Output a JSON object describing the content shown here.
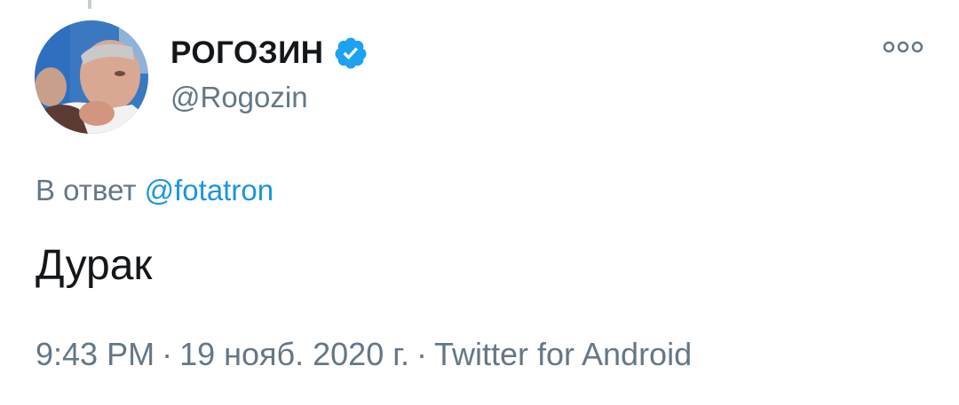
{
  "tweet": {
    "display_name": "РОГОЗИН",
    "handle": "@Rogozin",
    "reply_prefix": "В ответ",
    "reply_mention": "@fotatron",
    "text": "Дурак",
    "time": "9:43 PM",
    "date": "19 нояб. 2020 г.",
    "source": "Twitter for Android",
    "separator": "·"
  },
  "icons": {
    "verified": "verified-badge-icon",
    "more": "more-options-icon"
  },
  "colors": {
    "verified_blue": "#1da1f2",
    "link_blue": "#1b95e0",
    "secondary_text": "#657786",
    "primary_text": "#14171a"
  }
}
